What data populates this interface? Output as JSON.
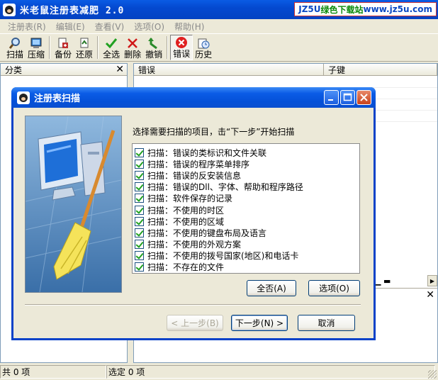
{
  "app": {
    "title": "米老鼠注册表减肥 2.0"
  },
  "brand": {
    "prefix": "JZ5U",
    "middle": "绿色下载站",
    "url": "www.jz5u.com"
  },
  "menu": [
    "注册表(R)",
    "编辑(E)",
    "查看(V)",
    "选项(O)",
    "帮助(H)"
  ],
  "toolbar": {
    "scan": "扫描",
    "compress": "压缩",
    "backup": "备份",
    "restore": "还原",
    "select_all": "全选",
    "delete": "删除",
    "undo": "撤销",
    "errors": "错误",
    "history": "历史"
  },
  "left_pane": {
    "header": "分类"
  },
  "right_pane": {
    "col_error": "错误",
    "col_subkey": "子键"
  },
  "status": {
    "total": "共 0 项",
    "selected": "选定 0 项"
  },
  "dialog": {
    "title": "注册表扫描",
    "prompt": "选择需要扫描的项目，击“下一步”开始扫描",
    "items": [
      "扫描：错误的类标识和文件关联",
      "扫描：错误的程序菜单排序",
      "扫描：错误的反安装信息",
      "扫描：错误的Dll、字体、帮助和程序路径",
      "扫描：软件保存的记录",
      "扫描：不使用的时区",
      "扫描：不使用的区域",
      "扫描：不使用的键盘布局及语言",
      "扫描：不使用的外观方案",
      "扫描：不使用的拨号国家(地区)和电话卡",
      "扫描：不存在的文件"
    ],
    "btn_none": "全否(A)",
    "btn_options": "选项(O)",
    "btn_prev": "< 上一步(B)",
    "btn_next": "下一步(N) >",
    "btn_cancel": "取消"
  },
  "colors": {
    "xp_blue": "#0842c8",
    "check_green": "#21a121",
    "delete_red": "#d01818"
  }
}
